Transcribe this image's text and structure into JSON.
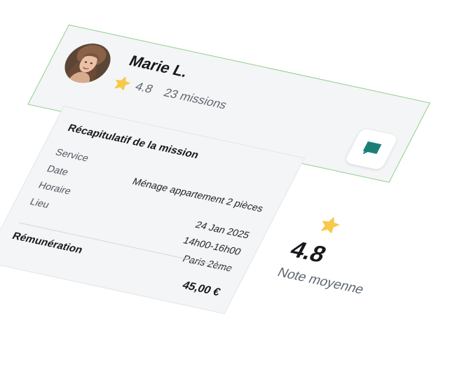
{
  "colors": {
    "star": "#f7c948",
    "chat_accent": "#1b7f78",
    "card_background": "#f4f5f6",
    "card_border_highlight": "#8fcf8a",
    "muted_text": "#5f6670"
  },
  "profile": {
    "name": "Marie L.",
    "rating": "4.8",
    "missions": "23 missions",
    "avatar_icon": "user-avatar-photo",
    "rating_icon": "star-icon",
    "chat_icon": "chat-bubble-icon"
  },
  "summary": {
    "title": "Récapitulatif de la mission",
    "rows": [
      {
        "label": "Service",
        "value": "Ménage appartement 2 pièces"
      },
      {
        "label": "Date",
        "value": "24 Jan 2025"
      },
      {
        "label": "Horaire",
        "value": "14h00-16h00"
      },
      {
        "label": "Lieu",
        "value": "Paris 2ème"
      }
    ],
    "total_label": "Rémunération",
    "total_value": "45,00 €"
  },
  "average": {
    "value": "4.8",
    "label": "Note moyenne",
    "icon": "star-icon"
  }
}
